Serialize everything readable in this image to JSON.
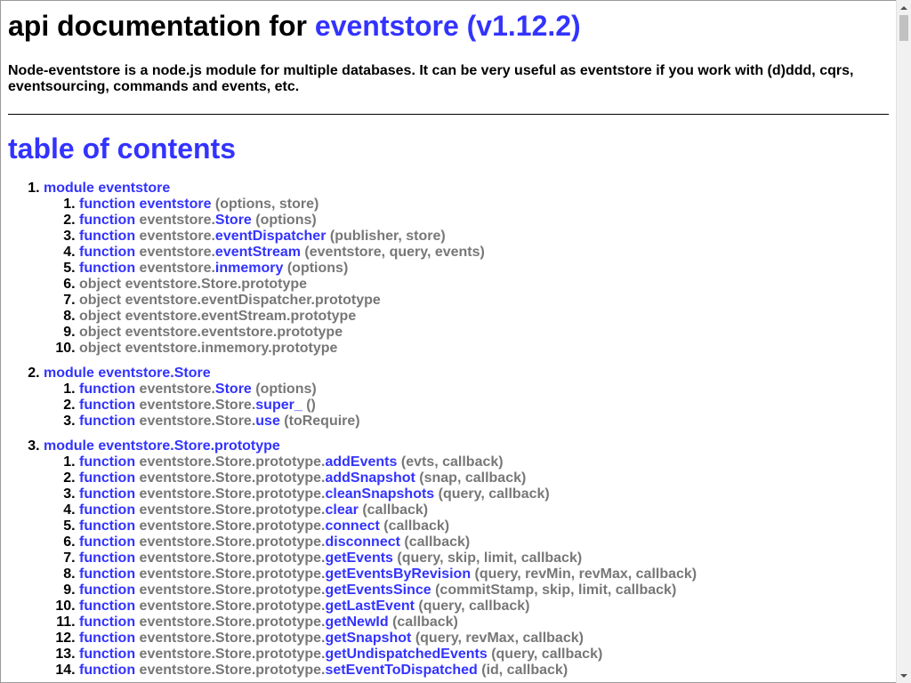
{
  "header": {
    "title_prefix": "api documentation for ",
    "title_link": "eventstore (v1.12.2)",
    "description": "Node-eventstore is a node.js module for multiple databases. It can be very useful as eventstore if you work with (d)ddd, cqrs, eventsourcing, commands and events, etc."
  },
  "toc": {
    "title": "table of contents",
    "modules": [
      {
        "label": "module eventstore",
        "items": [
          {
            "kind": "function",
            "prefix": "eventstore",
            "name": "",
            "link": "eventstore",
            "args": "(options, store)"
          },
          {
            "kind": "function",
            "prefix": "eventstore.",
            "link": "Store",
            "args": "(options)"
          },
          {
            "kind": "function",
            "prefix": "eventstore.",
            "link": "eventDispatcher",
            "args": "(publisher, store)"
          },
          {
            "kind": "function",
            "prefix": "eventstore.",
            "link": "eventStream",
            "args": "(eventstore, query, events)"
          },
          {
            "kind": "function",
            "prefix": "eventstore.",
            "link": "inmemory",
            "args": "(options)"
          },
          {
            "kind": "object",
            "prefix": "eventstore.Store.prototype"
          },
          {
            "kind": "object",
            "prefix": "eventstore.eventDispatcher.prototype"
          },
          {
            "kind": "object",
            "prefix": "eventstore.eventStream.prototype"
          },
          {
            "kind": "object",
            "prefix": "eventstore.eventstore.prototype"
          },
          {
            "kind": "object",
            "prefix": "eventstore.inmemory.prototype"
          }
        ]
      },
      {
        "label": "module eventstore.Store",
        "items": [
          {
            "kind": "function",
            "prefix": "eventstore.",
            "link": "Store",
            "args": "(options)"
          },
          {
            "kind": "function",
            "prefix": "eventstore.Store.",
            "link": "super_",
            "args": "()"
          },
          {
            "kind": "function",
            "prefix": "eventstore.Store.",
            "link": "use",
            "args": "(toRequire)"
          }
        ]
      },
      {
        "label": "module eventstore.Store.prototype",
        "items": [
          {
            "kind": "function",
            "prefix": "eventstore.Store.prototype.",
            "link": "addEvents",
            "args": "(evts, callback)"
          },
          {
            "kind": "function",
            "prefix": "eventstore.Store.prototype.",
            "link": "addSnapshot",
            "args": "(snap, callback)"
          },
          {
            "kind": "function",
            "prefix": "eventstore.Store.prototype.",
            "link": "cleanSnapshots",
            "args": "(query, callback)"
          },
          {
            "kind": "function",
            "prefix": "eventstore.Store.prototype.",
            "link": "clear",
            "args": "(callback)"
          },
          {
            "kind": "function",
            "prefix": "eventstore.Store.prototype.",
            "link": "connect",
            "args": "(callback)"
          },
          {
            "kind": "function",
            "prefix": "eventstore.Store.prototype.",
            "link": "disconnect",
            "args": "(callback)"
          },
          {
            "kind": "function",
            "prefix": "eventstore.Store.prototype.",
            "link": "getEvents",
            "args": "(query, skip, limit, callback)"
          },
          {
            "kind": "function",
            "prefix": "eventstore.Store.prototype.",
            "link": "getEventsByRevision",
            "args": "(query, revMin, revMax, callback)"
          },
          {
            "kind": "function",
            "prefix": "eventstore.Store.prototype.",
            "link": "getEventsSince",
            "args": "(commitStamp, skip, limit, callback)"
          },
          {
            "kind": "function",
            "prefix": "eventstore.Store.prototype.",
            "link": "getLastEvent",
            "args": "(query, callback)"
          },
          {
            "kind": "function",
            "prefix": "eventstore.Store.prototype.",
            "link": "getNewId",
            "args": "(callback)"
          },
          {
            "kind": "function",
            "prefix": "eventstore.Store.prototype.",
            "link": "getSnapshot",
            "args": "(query, revMax, callback)"
          },
          {
            "kind": "function",
            "prefix": "eventstore.Store.prototype.",
            "link": "getUndispatchedEvents",
            "args": "(query, callback)"
          },
          {
            "kind": "function",
            "prefix": "eventstore.Store.prototype.",
            "link": "setEventToDispatched",
            "args": "(id, callback)"
          }
        ]
      }
    ]
  },
  "colors": {
    "link": "#3333ff",
    "muted": "#777777",
    "text": "#000000"
  }
}
